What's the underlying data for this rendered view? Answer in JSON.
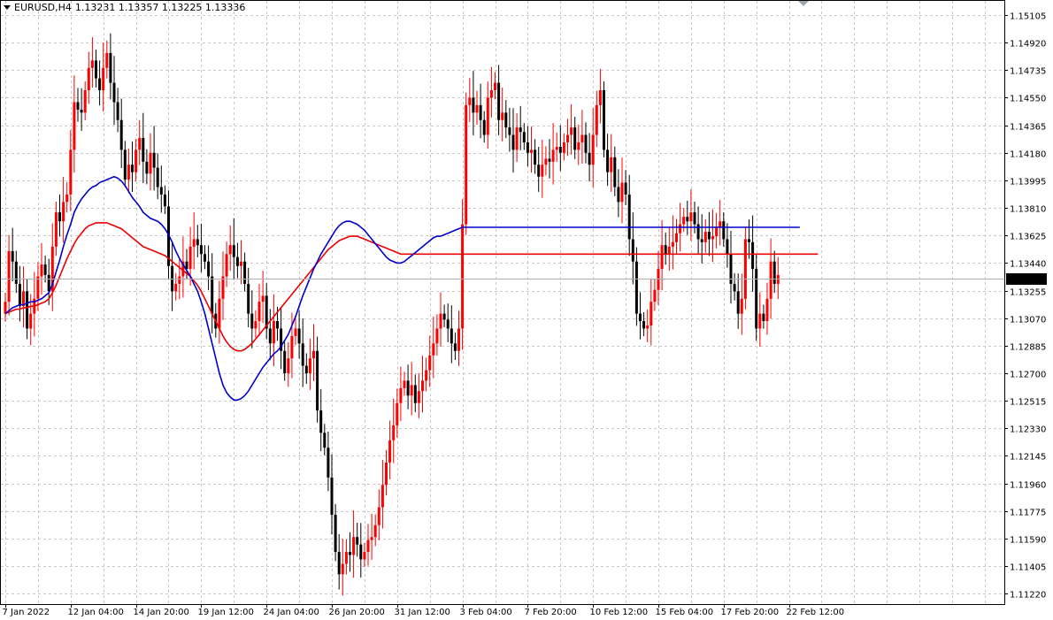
{
  "header": {
    "symbol_label": "EURUSD,H4",
    "ohlc": "1.13231 1.13357 1.13225 1.13336"
  },
  "colors": {
    "bull": "#ff0000",
    "bear": "#000000",
    "ma_fast": "#0000cc",
    "ma_slow": "#ee0000",
    "grid": "#c8c8c8",
    "price_marker_bg": "#000000",
    "price_marker_text": "#ffffff"
  },
  "icons": {
    "collapse": "triangle-down-icon",
    "shift": "chart-shift-triangle-icon"
  },
  "chart_data": {
    "type": "candlestick",
    "symbol": "EURUSD",
    "timeframe": "H4",
    "current_price": 1.13336,
    "ylim": [
      1.1115,
      1.152
    ],
    "y_ticks": [
      "1.15105",
      "1.14920",
      "1.14735",
      "1.14550",
      "1.14365",
      "1.14180",
      "1.13995",
      "1.13810",
      "1.13625",
      "1.13440",
      "1.13255",
      "1.13070",
      "1.12885",
      "1.12700",
      "1.12515",
      "1.12330",
      "1.12145",
      "1.11960",
      "1.11775",
      "1.11590",
      "1.11405",
      "1.11220"
    ],
    "x_labels": [
      {
        "i": 0,
        "label": "7 Jan 2022"
      },
      {
        "i": 18,
        "label": "12 Jan 04:00"
      },
      {
        "i": 36,
        "label": "14 Jan 20:00"
      },
      {
        "i": 54,
        "label": "19 Jan 12:00"
      },
      {
        "i": 72,
        "label": "24 Jan 04:00"
      },
      {
        "i": 90,
        "label": "26 Jan 20:00"
      },
      {
        "i": 108,
        "label": "31 Jan 12:00"
      },
      {
        "i": 126,
        "label": "3 Feb 04:00"
      },
      {
        "i": 144,
        "label": "7 Feb 20:00"
      },
      {
        "i": 162,
        "label": "10 Feb 12:00"
      },
      {
        "i": 180,
        "label": "15 Feb 04:00"
      },
      {
        "i": 198,
        "label": "17 Feb 20:00"
      },
      {
        "i": 216,
        "label": "22 Feb 12:00"
      }
    ],
    "close": [
      1.1318,
      1.1352,
      1.1345,
      1.133,
      1.1315,
      1.1325,
      1.13,
      1.131,
      1.132,
      1.1335,
      1.1343,
      1.1336,
      1.1325,
      1.1355,
      1.1378,
      1.1372,
      1.1385,
      1.139,
      1.142,
      1.1452,
      1.1447,
      1.1445,
      1.146,
      1.1475,
      1.148,
      1.1468,
      1.146,
      1.1475,
      1.1485,
      1.1465,
      1.1452,
      1.144,
      1.142,
      1.14,
      1.141,
      1.1405,
      1.142,
      1.1428,
      1.1412,
      1.1404,
      1.1418,
      1.1408,
      1.1395,
      1.139,
      1.1382,
      1.1342,
      1.1325,
      1.133,
      1.1335,
      1.1345,
      1.134,
      1.1355,
      1.136,
      1.1356,
      1.135,
      1.1345,
      1.1335,
      1.131,
      1.13,
      1.132,
      1.1335,
      1.135,
      1.1356,
      1.1348,
      1.1342,
      1.1345,
      1.133,
      1.131,
      1.13,
      1.1305,
      1.1318,
      1.1322,
      1.13,
      1.129,
      1.1305,
      1.13,
      1.1285,
      1.127,
      1.128,
      1.1295,
      1.13,
      1.129,
      1.1275,
      1.127,
      1.128,
      1.1285,
      1.1245,
      1.123,
      1.122,
      1.12,
      1.1175,
      1.115,
      1.1135,
      1.1142,
      1.115,
      1.1148,
      1.116,
      1.1155,
      1.1145,
      1.115,
      1.1158,
      1.116,
      1.1168,
      1.118,
      1.1195,
      1.121,
      1.1225,
      1.1235,
      1.125,
      1.126,
      1.1265,
      1.1255,
      1.1262,
      1.125,
      1.1258,
      1.1265,
      1.1272,
      1.1282,
      1.129,
      1.13,
      1.131,
      1.1306,
      1.13,
      1.129,
      1.1285,
      1.13,
      1.137,
      1.145,
      1.1455,
      1.1445,
      1.145,
      1.144,
      1.143,
      1.1455,
      1.146,
      1.1465,
      1.144,
      1.1445,
      1.1435,
      1.143,
      1.142,
      1.1435,
      1.1432,
      1.1425,
      1.1418,
      1.142,
      1.141,
      1.1402,
      1.141,
      1.1414,
      1.1412,
      1.142,
      1.1422,
      1.1418,
      1.1425,
      1.143,
      1.1435,
      1.142,
      1.1425,
      1.143,
      1.1418,
      1.141,
      1.143,
      1.145,
      1.146,
      1.142,
      1.1405,
      1.1415,
      1.1395,
      1.1385,
      1.1398,
      1.139,
      1.136,
      1.1345,
      1.131,
      1.1305,
      1.13,
      1.1302,
      1.1318,
      1.1326,
      1.134,
      1.1356,
      1.135,
      1.1355,
      1.1358,
      1.1364,
      1.137,
      1.1375,
      1.1372,
      1.1378,
      1.137,
      1.136,
      1.1358,
      1.1365,
      1.136,
      1.1362,
      1.1368,
      1.1372,
      1.136,
      1.135,
      1.133,
      1.1325,
      1.131,
      1.132,
      1.136,
      1.1358,
      1.134,
      1.13,
      1.131,
      1.1305,
      1.132,
      1.1345,
      1.133,
      1.1336
    ],
    "ma_fast": [
      1.131,
      1.1312,
      1.1314,
      1.1315,
      1.1316,
      1.1316,
      1.1317,
      1.1318,
      1.1318,
      1.1319,
      1.132,
      1.1322,
      1.1324,
      1.133,
      1.1338,
      1.1346,
      1.1355,
      1.1363,
      1.137,
      1.1378,
      1.1383,
      1.1387,
      1.139,
      1.1393,
      1.1395,
      1.1396,
      1.1398,
      1.1399,
      1.14,
      1.1401,
      1.1402,
      1.1401,
      1.1399,
      1.1396,
      1.1392,
      1.1388,
      1.1385,
      1.1382,
      1.1378,
      1.1376,
      1.1374,
      1.1373,
      1.1372,
      1.137,
      1.1367,
      1.1363,
      1.1358,
      1.1352,
      1.1347,
      1.1343,
      1.1339,
      1.1335,
      1.133,
      1.1325,
      1.1318,
      1.131,
      1.13,
      1.129,
      1.128,
      1.127,
      1.1262,
      1.1257,
      1.1254,
      1.1252,
      1.1252,
      1.1253,
      1.1255,
      1.1258,
      1.1262,
      1.1266,
      1.127,
      1.1274,
      1.1277,
      1.128,
      1.1283,
      1.1285,
      1.1288,
      1.1292,
      1.1296,
      1.1302,
      1.1308,
      1.1315,
      1.1322,
      1.1328,
      1.1334,
      1.134,
      1.1345,
      1.135,
      1.1354,
      1.1358,
      1.1362,
      1.1366,
      1.1369,
      1.1371,
      1.1372,
      1.1372,
      1.1371,
      1.137,
      1.1368,
      1.1366,
      1.1363,
      1.136,
      1.1357,
      1.1354,
      1.1351,
      1.1348,
      1.1346,
      1.1345,
      1.1344,
      1.1344,
      1.1345,
      1.1347,
      1.1349,
      1.1351,
      1.1353,
      1.1355,
      1.1357,
      1.1359,
      1.1361,
      1.1362,
      1.1362,
      1.1363,
      1.1364,
      1.1365,
      1.1366,
      1.1367,
      1.1368,
      1.1368,
      1.1368,
      1.1368,
      1.1368,
      1.1368,
      1.1368,
      1.1368,
      1.1368,
      1.1368,
      1.1368,
      1.1368,
      1.1368,
      1.1368,
      1.1368,
      1.1368,
      1.1368,
      1.1368,
      1.1368,
      1.1368,
      1.1368,
      1.1368,
      1.1368,
      1.1368,
      1.1368,
      1.1368,
      1.1368,
      1.1368,
      1.1368,
      1.1368,
      1.1368,
      1.1368,
      1.1368,
      1.1368,
      1.1368,
      1.1368,
      1.1368,
      1.1368,
      1.1368,
      1.1368,
      1.1368,
      1.1368,
      1.1368,
      1.1368,
      1.1368,
      1.1368,
      1.1368,
      1.1368,
      1.1368,
      1.1368,
      1.1368,
      1.1368,
      1.1368,
      1.1368,
      1.1368,
      1.1368,
      1.1368,
      1.1368,
      1.1368,
      1.1368,
      1.1368,
      1.1368,
      1.1368,
      1.1368,
      1.1368,
      1.1368,
      1.1368,
      1.1368,
      1.1368,
      1.1368,
      1.1368,
      1.1368,
      1.1368,
      1.1368,
      1.1368,
      1.1368,
      1.1368,
      1.1368,
      1.1368,
      1.1368,
      1.1368,
      1.1368,
      1.1368,
      1.1368,
      1.1368,
      1.1368,
      1.1368,
      1.1368,
      1.1368,
      1.1368,
      1.1368,
      1.1368,
      1.1368,
      1.1368
    ],
    "ma_slow": [
      1.131,
      1.1311,
      1.1312,
      1.1313,
      1.1313,
      1.1314,
      1.1314,
      1.1315,
      1.1315,
      1.1316,
      1.1317,
      1.1318,
      1.132,
      1.1324,
      1.1329,
      1.1335,
      1.1341,
      1.1347,
      1.1352,
      1.1357,
      1.1361,
      1.1364,
      1.1367,
      1.1369,
      1.137,
      1.1371,
      1.1371,
      1.1371,
      1.1371,
      1.137,
      1.1369,
      1.1368,
      1.1367,
      1.1365,
      1.1363,
      1.1361,
      1.1359,
      1.1357,
      1.1355,
      1.1354,
      1.1353,
      1.1352,
      1.1351,
      1.135,
      1.1349,
      1.1347,
      1.1345,
      1.1343,
      1.1341,
      1.1339,
      1.1337,
      1.1335,
      1.1332,
      1.1329,
      1.1325,
      1.132,
      1.1315,
      1.131,
      1.1305,
      1.13,
      1.1295,
      1.1291,
      1.1288,
      1.1286,
      1.1285,
      1.1285,
      1.1286,
      1.1288,
      1.129,
      1.1293,
      1.1296,
      1.1299,
      1.1302,
      1.1305,
      1.1308,
      1.1311,
      1.1314,
      1.1317,
      1.132,
      1.1323,
      1.1326,
      1.1329,
      1.1332,
      1.1335,
      1.1338,
      1.1341,
      1.1344,
      1.1347,
      1.135,
      1.1353,
      1.1355,
      1.1357,
      1.1359,
      1.136,
      1.1361,
      1.1362,
      1.1362,
      1.1362,
      1.1361,
      1.136,
      1.1359,
      1.1358,
      1.1357,
      1.1356,
      1.1355,
      1.1354,
      1.1353,
      1.1352,
      1.1351,
      1.135,
      1.135,
      1.135,
      1.135,
      1.135,
      1.135,
      1.135,
      1.135,
      1.135,
      1.135,
      1.135,
      1.135,
      1.135,
      1.135,
      1.135,
      1.135,
      1.135,
      1.135,
      1.135,
      1.135,
      1.135,
      1.135,
      1.135,
      1.135,
      1.135,
      1.135,
      1.135,
      1.135,
      1.135,
      1.135,
      1.135,
      1.135,
      1.135,
      1.135,
      1.135,
      1.135,
      1.135,
      1.135,
      1.135,
      1.135,
      1.135,
      1.135,
      1.135,
      1.135,
      1.135,
      1.135,
      1.135,
      1.135,
      1.135,
      1.135,
      1.135,
      1.135,
      1.135,
      1.135,
      1.135,
      1.135,
      1.135,
      1.135,
      1.135,
      1.135,
      1.135,
      1.135,
      1.135,
      1.135,
      1.135,
      1.135,
      1.135,
      1.135,
      1.135,
      1.135,
      1.135,
      1.135,
      1.135,
      1.135,
      1.135,
      1.135,
      1.135,
      1.135,
      1.135,
      1.135,
      1.135,
      1.135,
      1.135,
      1.135,
      1.135,
      1.135,
      1.135,
      1.135,
      1.135,
      1.135,
      1.135,
      1.135,
      1.135,
      1.135,
      1.135,
      1.135,
      1.135,
      1.135,
      1.135,
      1.135,
      1.135,
      1.135,
      1.135,
      1.135,
      1.135,
      1.135,
      1.135,
      1.135,
      1.135,
      1.135,
      1.135,
      1.135,
      1.135,
      1.135,
      1.135,
      1.135
    ]
  }
}
